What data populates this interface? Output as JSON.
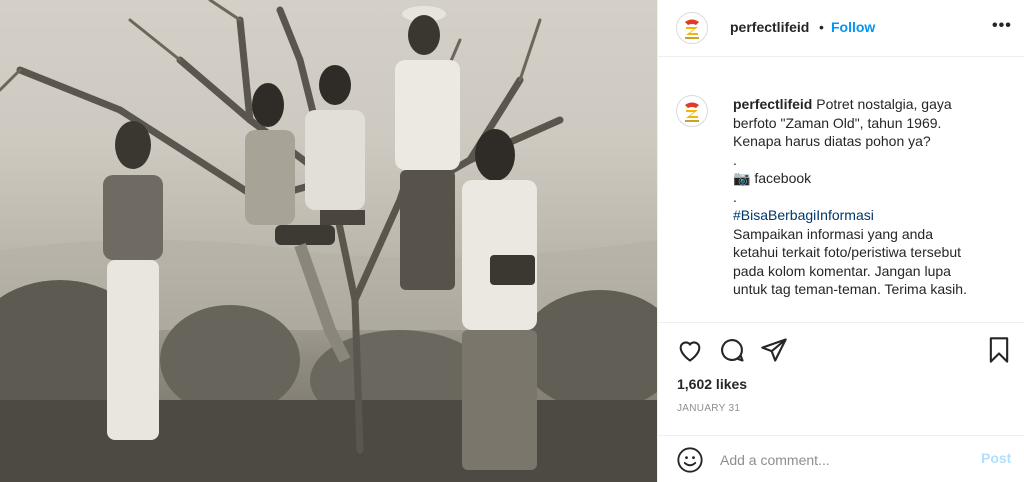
{
  "post": {
    "image_alt": "vintage photo of five girls posing on a tree"
  },
  "header": {
    "username": "perfectlifeid",
    "separator": "•",
    "follow_label": "Follow",
    "more_label": "•••"
  },
  "caption": {
    "username": "perfectlifeid",
    "lines": [
      "Potret nostalgia, gaya",
      "berfoto \"Zaman Old\", tahun 1969.",
      "Kenapa harus diatas pohon ya?",
      ".",
      "📷 facebook",
      ".",
      "#BisaBerbagiInformasi",
      "Sampaikan informasi yang anda",
      "ketahui terkait foto/peristiwa tersebut",
      "pada kolom komentar. Jangan lupa",
      "untuk tag teman-teman. Terima kasih."
    ]
  },
  "actions": {
    "like_icon": "heart-icon",
    "comment_icon": "comment-icon",
    "share_icon": "share-icon",
    "save_icon": "bookmark-icon"
  },
  "likes_text": "1,602 likes",
  "date_text": "JANUARY 31",
  "comment": {
    "placeholder": "Add a comment...",
    "post_label": "Post"
  },
  "colors": {
    "link": "#0095f6",
    "hashtag": "#00376b",
    "muted": "#8e8e8e",
    "post_disabled": "#b2dffc"
  }
}
